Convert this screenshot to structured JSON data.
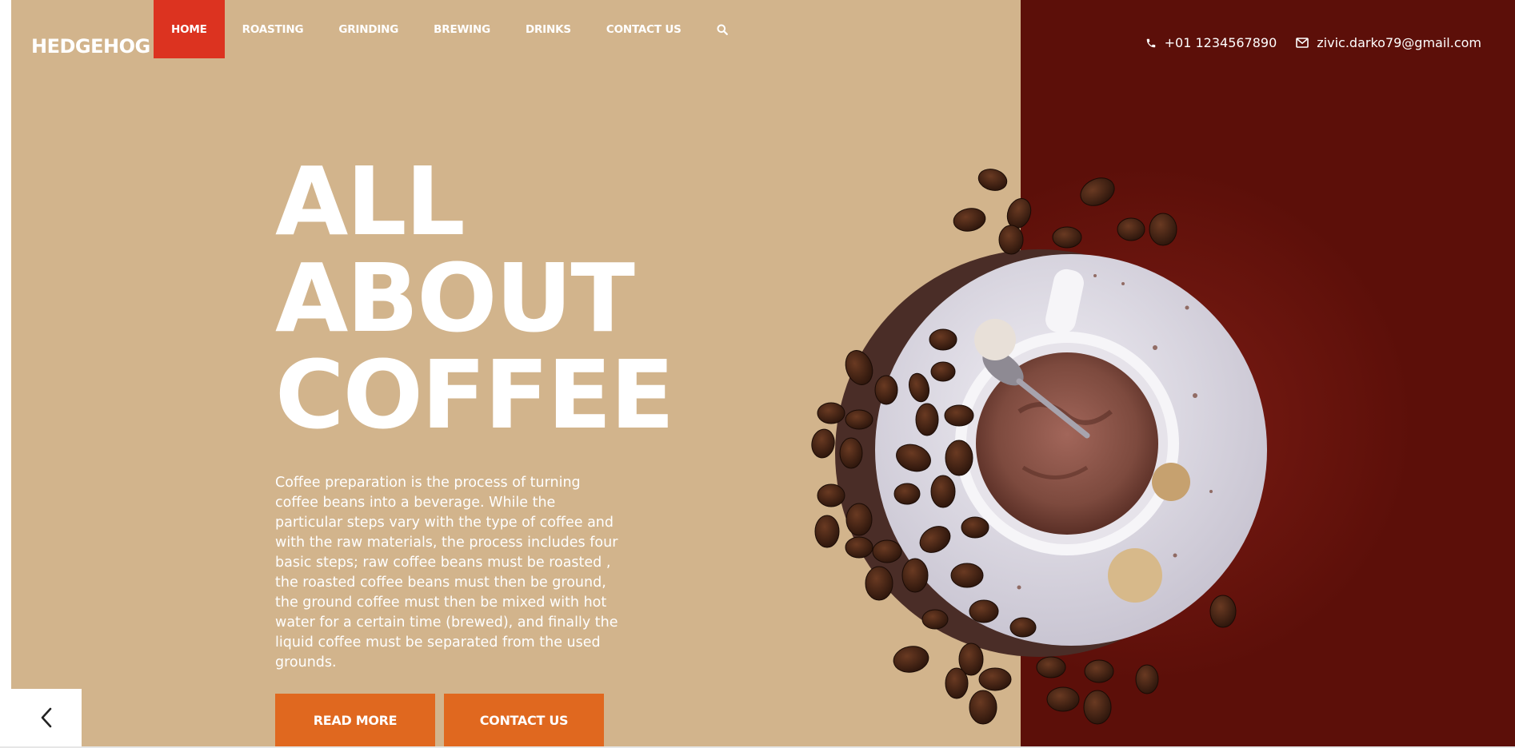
{
  "brand": {
    "logo": "HEDGEHOG"
  },
  "nav": {
    "items": [
      {
        "label": "HOME",
        "active": true
      },
      {
        "label": "ROASTING"
      },
      {
        "label": "GRINDING"
      },
      {
        "label": "BREWING"
      },
      {
        "label": "DRINKS"
      },
      {
        "label": "CONTACT US"
      }
    ],
    "search_icon": "search-icon"
  },
  "contact": {
    "phone": "+01 1234567890",
    "email": "zivic.darko79@gmail.com",
    "phone_icon": "phone-icon",
    "email_icon": "envelope-icon"
  },
  "hero": {
    "title_lines": [
      "ALL",
      "ABOUT",
      "COFFEE"
    ],
    "text": "Coffee preparation is the process of turning coffee beans into a beverage. While the particular steps vary with the type of coffee and with the raw materials, the process includes four basic steps; raw coffee beans must be roasted , the roasted coffee beans must then be ground, the ground coffee must then be mixed with hot water for a certain time (brewed), and finally the liquid coffee must be separated from the used grounds.",
    "buttons": {
      "read_more": "READ MORE",
      "contact_us": "CONTACT US"
    },
    "image": "coffee-cup-with-beans"
  },
  "slider": {
    "prev_icon": "chevron-left-icon"
  },
  "colors": {
    "left_bg": "#d2b48c",
    "right_bg": "#5c0f09",
    "accent_red": "#dc3320",
    "button_orange": "#e0681f"
  }
}
